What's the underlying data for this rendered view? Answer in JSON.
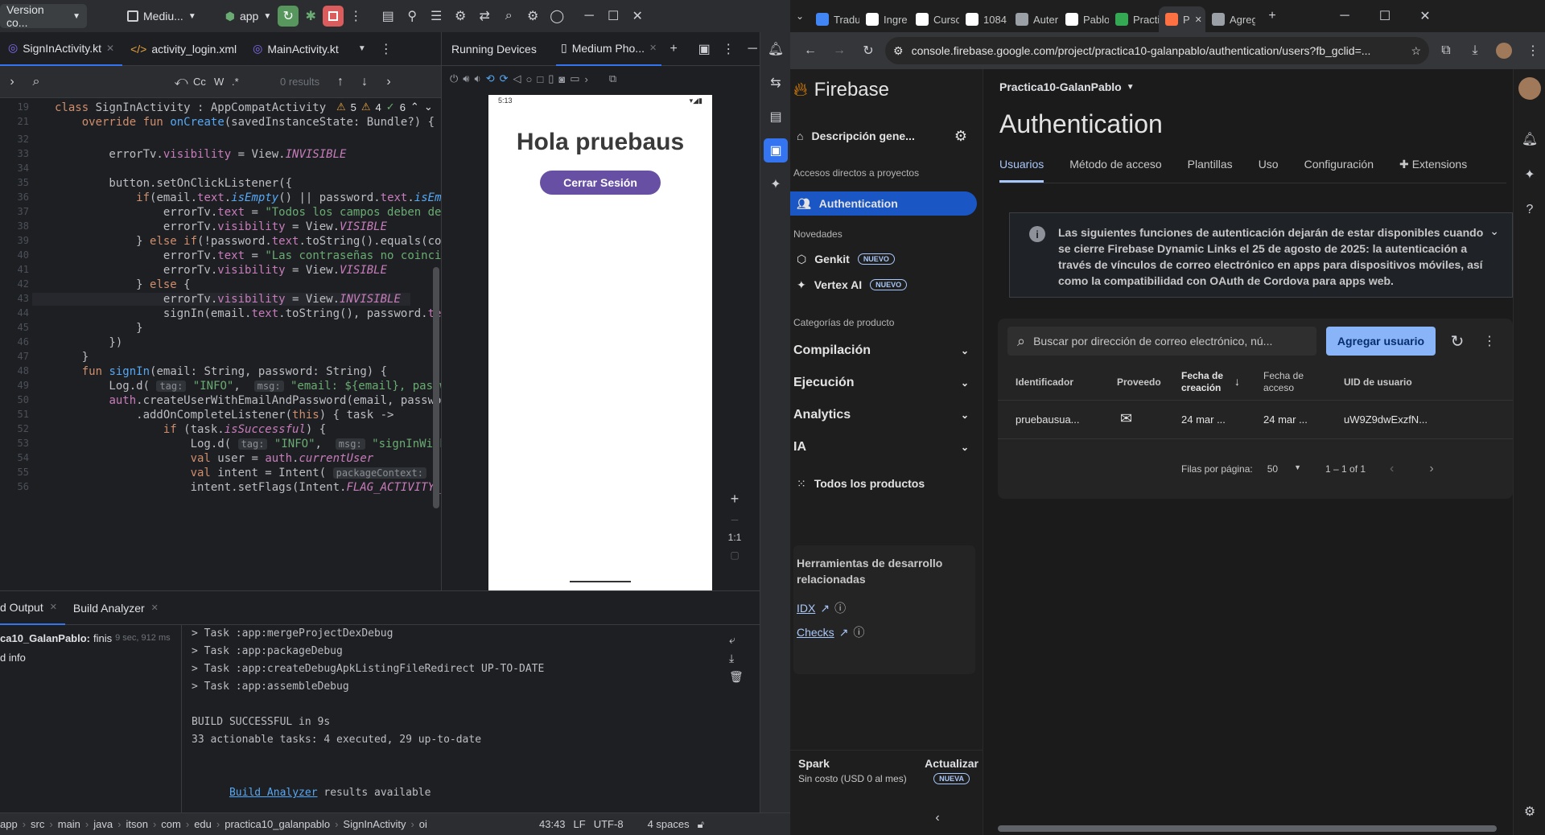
{
  "studio": {
    "title_bar": {
      "vcs": "Version co...",
      "project": "Mediu...",
      "run_config": "app"
    },
    "file_tabs": [
      "SignInActivity.kt",
      "activity_login.xml",
      "MainActivity.kt"
    ],
    "find": {
      "results": "0 results",
      "cc": "Cc",
      "w": "W",
      "regex": ".*"
    },
    "inspections": {
      "warnings": "5",
      "weak": "4",
      "ok": "6"
    },
    "code_lines": [
      {
        "n": "19",
        "html": "<span class=\"kw\">class</span> SignInActivity : AppCompatActivity"
      },
      {
        "n": "21",
        "html": "    <span class=\"kw\">override fun</span> <span class=\"fn\">onCreate</span>(savedInstanceState: Bundle?) {"
      },
      {
        "n": "32",
        "html": ""
      },
      {
        "n": "33",
        "html": "        errorTv.<span class=\"prop\">visibility</span> = View.<span class=\"prop it\">INVISIBLE</span>"
      },
      {
        "n": "34",
        "html": ""
      },
      {
        "n": "35",
        "html": "        button.setOnClickListener({"
      },
      {
        "n": "36",
        "html": "            <span class=\"kw\">if</span>(email.<span class=\"prop\">text</span>.<span class=\"fn it\">isEmpty</span>() || password.<span class=\"prop\">text</span>.<span class=\"fn it\">isEmp</span>"
      },
      {
        "n": "37",
        "html": "                errorTv.<span class=\"prop\">text</span> = <span class=\"str\">\"Todos los campos deben de</span>"
      },
      {
        "n": "38",
        "html": "                errorTv.<span class=\"prop\">visibility</span> = View.<span class=\"prop it\">VISIBLE</span>"
      },
      {
        "n": "39",
        "html": "            } <span class=\"kw\">else if</span>(!password.<span class=\"prop\">text</span>.toString().equals(co"
      },
      {
        "n": "40",
        "html": "                errorTv.<span class=\"prop\">text</span> = <span class=\"str\">\"Las contraseñas no coinci</span>"
      },
      {
        "n": "41",
        "html": "                errorTv.<span class=\"prop\">visibility</span> = View.<span class=\"prop it\">VISIBLE</span>"
      },
      {
        "n": "42",
        "html": "            } <span class=\"kw\">else</span> {"
      },
      {
        "n": "43",
        "html": "                errorTv.<span class=\"prop\">visibility</span> = View.<span class=\"prop it\">INVISIBLE</span>"
      },
      {
        "n": "44",
        "html": "                signIn(email.<span class=\"prop\">text</span>.toString(), password.<span class=\"prop\">te</span>"
      },
      {
        "n": "45",
        "html": "            }"
      },
      {
        "n": "46",
        "html": "        })"
      },
      {
        "n": "47",
        "html": "    }"
      },
      {
        "n": "48",
        "html": "    <span class=\"kw\">fun</span> <span class=\"fn\">signIn</span>(email: String, password: String) {"
      },
      {
        "n": "49",
        "html": "        Log.d( <span class=\"hint\">tag:</span> <span class=\"str\">\"INFO\"</span>,  <span class=\"hint\">msg:</span> <span class=\"str\">\"email: ${email}, passwor</span>"
      },
      {
        "n": "50",
        "html": "        <span class=\"prop\">auth</span>.createUserWithEmailAndPassword(email, passwor"
      },
      {
        "n": "51",
        "html": "            .addOnCompleteListener(<span class=\"kw\">this</span>) { task ->"
      },
      {
        "n": "52",
        "html": "                <span class=\"kw\">if</span> (task.<span class=\"prop it\">isSuccessful</span>) {"
      },
      {
        "n": "53",
        "html": "                    Log.d( <span class=\"hint\">tag:</span> <span class=\"str\">\"INFO\"</span>,  <span class=\"hint\">msg:</span> <span class=\"str\">\"signInWithEma</span>"
      },
      {
        "n": "54",
        "html": "                    <span class=\"kw\">val</span> user = <span class=\"prop\">auth</span>.<span class=\"prop it\">currentUser</span>"
      },
      {
        "n": "55",
        "html": "                    <span class=\"kw\">val</span> intent = Intent( <span class=\"hint\">packageContext:</span> <span class=\"kw\">this</span>"
      },
      {
        "n": "56",
        "html": "                    intent.setFlags(Intent.<span class=\"prop it\">FLAG_ACTIVITY_</span>"
      }
    ],
    "devices": {
      "title": "Running Devices",
      "tab": "Medium Pho...",
      "zoom_label": "1:1"
    },
    "phone": {
      "time": "5:13",
      "heading": "Hola pruebaus",
      "button": "Cerrar Sesión"
    },
    "bottom": {
      "tabs": [
        "d Output",
        "Build Analyzer"
      ],
      "tree": [
        {
          "label": "ca10_GalanPablo:",
          "status": "finis",
          "time": "9 sec, 912 ms"
        },
        {
          "label": "d info",
          "status": "",
          "time": ""
        }
      ],
      "log": [
        "> Task :app:mergeProjectDexDebug",
        "> Task :app:packageDebug",
        "> Task :app:createDebugApkListingFileRedirect UP-TO-DATE",
        "> Task :app:assembleDebug",
        "",
        "BUILD SUCCESSFUL in 9s",
        "33 actionable tasks: 4 executed, 29 up-to-date",
        ""
      ],
      "link": "Build Analyzer",
      "link_suffix": " results available"
    },
    "status_bar": {
      "crumbs": [
        "app",
        "src",
        "main",
        "java",
        "itson",
        "com",
        "edu",
        "practica10_galanpablo",
        "SignInActivity",
        "oi"
      ],
      "position": "43:43",
      "line_sep": "LF",
      "encoding": "UTF-8",
      "indent": "4 spaces"
    }
  },
  "chrome": {
    "tabs": [
      {
        "label": "Tradu",
        "color": "#4285f4"
      },
      {
        "label": "Ingre",
        "color": "#ffffff"
      },
      {
        "label": "Curso",
        "color": "#ffffff"
      },
      {
        "label": "1084",
        "color": "#ffffff"
      },
      {
        "label": "Auter",
        "color": "#9aa0a6"
      },
      {
        "label": "Pablo",
        "color": "#ffffff"
      },
      {
        "label": "Practi",
        "color": "#34a853"
      },
      {
        "label": "P",
        "color": "#ff7043"
      },
      {
        "label": "Agreg",
        "color": "#9aa0a6"
      }
    ],
    "url": "console.firebase.google.com/project/practica10-galanpablo/authentication/users?fb_gclid=..."
  },
  "firebase": {
    "brand": "Firebase",
    "project": "Practica10-GalanPablo",
    "overview": "Descripción gene...",
    "shortcuts_header": "Accesos directos a proyectos",
    "shortcut_active": "Authentication",
    "news_header": "Novedades",
    "news": [
      {
        "label": "Genkit",
        "badge": "NUEVO"
      },
      {
        "label": "Vertex AI",
        "badge": "NUEVO"
      }
    ],
    "categories_header": "Categorías de producto",
    "categories": [
      "Compilación",
      "Ejecución",
      "Analytics",
      "IA"
    ],
    "all_products": "Todos los productos",
    "dev_tools": "Herramientas de desarrollo relacionadas",
    "links": [
      "IDX",
      "Checks"
    ],
    "plan": "Spark",
    "plan_sub": "Sin costo (USD 0 al mes)",
    "upgrade": "Actualizar",
    "upgrade_badge": "NUEVA",
    "page_title": "Authentication",
    "tabs": [
      "Usuarios",
      "Método de acceso",
      "Plantillas",
      "Uso",
      "Configuración",
      "Extensions"
    ],
    "notice": "Las siguientes funciones de autenticación dejarán de estar disponibles cuando se cierre Firebase Dynamic Links el 25 de agosto de 2025: la autenticación a través de vínculos de correo electrónico en apps para dispositivos móviles, así como la compatibilidad con OAuth de Cordova para apps web.",
    "search_placeholder": "Buscar por dirección de correo electrónico, nú...",
    "add_user": "Agregar usuario",
    "columns": {
      "id": "Identificador",
      "provider": "Proveedo",
      "created": "Fecha de creación",
      "accessed": "Fecha de acceso",
      "uid": "UID de usuario"
    },
    "rows": [
      {
        "id": "pruebausua...",
        "created": "24 mar ...",
        "accessed": "24 mar ...",
        "uid": "uW9Z9dwExzfN..."
      }
    ],
    "pagination": {
      "rows_label": "Filas por página:",
      "rows_value": "50",
      "range": "1 – 1 of 1"
    }
  }
}
